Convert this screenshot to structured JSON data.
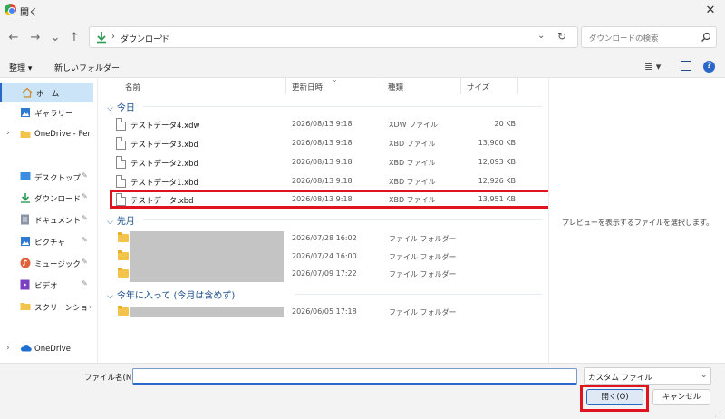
{
  "window": {
    "title": "開く",
    "close_symbol": "✕"
  },
  "nav": {
    "back": "←",
    "forward": "→",
    "recent": "⌄",
    "up": "↑",
    "address": "ダウンロード",
    "address_chevron": "›",
    "search_placeholder": "ダウンロードの検索"
  },
  "toolbar": {
    "organize": "整理 ▾",
    "new_folder": "新しいフォルダー",
    "view": "≣ ▾",
    "help": "?"
  },
  "sidebar": {
    "items": [
      {
        "label": "ホーム"
      },
      {
        "label": "ギャラリー"
      },
      {
        "label": "OneDrive - Pers"
      },
      {
        "label": "デスクトップ"
      },
      {
        "label": "ダウンロード"
      },
      {
        "label": "ドキュメント"
      },
      {
        "label": "ピクチャ"
      },
      {
        "label": "ミュージック"
      },
      {
        "label": "ビデオ"
      },
      {
        "label": "スクリーンショット"
      },
      {
        "label": "OneDrive"
      }
    ],
    "pin_symbol": "📌",
    "expand_symbol": "›"
  },
  "columns": {
    "name": "名前",
    "date": "更新日時",
    "type": "種類",
    "size": "サイズ"
  },
  "groups": [
    {
      "label": "今日",
      "files": [
        {
          "name": "テストデータ4.xdw",
          "date": "2026/08/13 9:18",
          "type": "XDW ファイル",
          "size": "20 KB"
        },
        {
          "name": "テストデータ3.xbd",
          "date": "2026/08/13 9:18",
          "type": "XBD ファイル",
          "size": "13,900 KB"
        },
        {
          "name": "テストデータ2.xbd",
          "date": "2026/08/13 9:18",
          "type": "XBD ファイル",
          "size": "12,093 KB"
        },
        {
          "name": "テストデータ1.xbd",
          "date": "2026/08/13 9:18",
          "type": "XBD ファイル",
          "size": "12,926 KB"
        },
        {
          "name": "テストデータ.xbd",
          "date": "2026/08/13 9:18",
          "type": "XBD ファイル",
          "size": "13,951 KB"
        }
      ]
    },
    {
      "label": "先月",
      "files": [
        {
          "date": "2026/07/28 16:02",
          "type": "ファイル フォルダー"
        },
        {
          "date": "2026/07/24 16:00",
          "type": "ファイル フォルダー"
        },
        {
          "date": "2026/07/09 17:22",
          "type": "ファイル フォルダー"
        }
      ]
    },
    {
      "label": "今年に入って (今月は含めず)",
      "files": [
        {
          "date": "2026/06/05 17:18",
          "type": "ファイル フォルダー"
        }
      ]
    }
  ],
  "preview": {
    "message": "プレビューを表示するファイルを選択します。"
  },
  "bottom": {
    "filename_label": "ファイル名(N):",
    "filename_value": "",
    "filter": "カスタム ファイル",
    "open": "開く(O)",
    "cancel": "キャンセル"
  },
  "colors": {
    "accent": "#2a67c9",
    "highlight": "#e0141e",
    "group_header": "#1b4f8a"
  }
}
